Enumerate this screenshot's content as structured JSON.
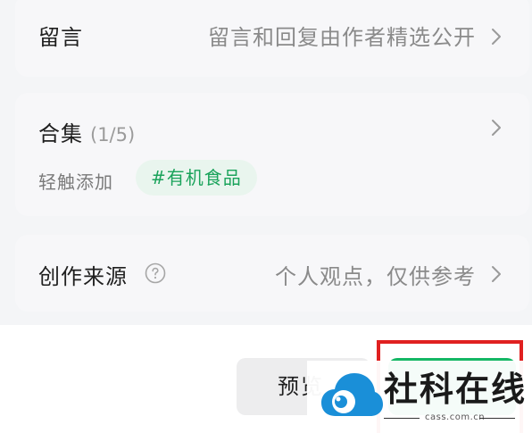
{
  "comment": {
    "title": "留言",
    "value": "留言和回复由作者精选公开"
  },
  "collection": {
    "title": "合集",
    "count": "(1/5)",
    "hint": "轻触添加",
    "tag": "#有机食品"
  },
  "source": {
    "title": "创作来源",
    "value": "个人观点，仅供参考"
  },
  "actions": {
    "preview_label": "预览"
  },
  "watermark": {
    "title": "社科在线",
    "url": "cass.com.cn"
  },
  "colors": {
    "accent_green": "#14b765",
    "tag_text": "#1aa35b",
    "tag_bg": "#e9f5ee",
    "highlight_red": "#e02020",
    "logo_blue": "#1a8fd8"
  }
}
